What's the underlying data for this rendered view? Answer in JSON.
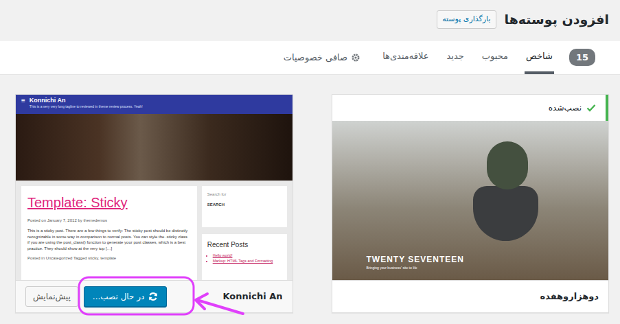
{
  "page": {
    "title": "افزودن پوسته‌ها",
    "upload_button": "بارگذاری پوسته"
  },
  "filter_bar": {
    "count": "15",
    "tabs": [
      {
        "label": "شاخص",
        "selected": true
      },
      {
        "label": "محبوب",
        "selected": false
      },
      {
        "label": "جدید",
        "selected": false
      },
      {
        "label": "علاقه‌مندی‌ها",
        "selected": false
      }
    ],
    "feature_filter": "صافی خصوصیات"
  },
  "themes": [
    {
      "name": "دوهزاروهفده",
      "kind": "photo",
      "installed": true,
      "installed_label": "نصب‌شده",
      "preview": {
        "title": "TWENTY SEVENTEEN",
        "tagline": "Bringing your business' site to life"
      }
    },
    {
      "name": "Konnichi An",
      "kind": "blog",
      "installed": false,
      "installing": true,
      "install_button": "در حال نصب...",
      "preview_button": "پیش‌نمایش",
      "preview": {
        "menu": "≡",
        "site_title": "Konnichi An",
        "tagline": "This is a very very long tagline to reviewed in theme review process. Yeah!",
        "post_title": "Template: Sticky",
        "meta": "Posted on January 7, 2012 by themedemos",
        "excerpt": "This is a sticky post. There are a few things to verify: The sticky post should be distinctly recognizable in some way in comparison to normal posts. You can style the .sticky class if you are using the post_class() function to generate your post classes, which is a best practice. They should show at the very top […]",
        "footer": "Posted in Uncategorized Tagged sticky, template",
        "search_label": "Search for",
        "search_button": "SEARCH",
        "widget_title": "Recent Posts",
        "recent": [
          "Hello world!",
          "Markup: HTML Tags and Formatting"
        ]
      }
    }
  ]
}
